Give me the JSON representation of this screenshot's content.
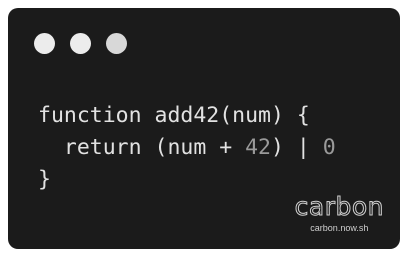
{
  "window": {
    "dots": [
      {
        "name": "window-dot-1",
        "color": "#ececec"
      },
      {
        "name": "window-dot-2",
        "color": "#ececec"
      },
      {
        "name": "window-dot-3",
        "color": "#d8d8d8"
      }
    ]
  },
  "code": {
    "line1": "function add42(num) {",
    "line2_a": "  return (num + ",
    "line2_num": "42",
    "line2_b": ") | ",
    "line2_num2": "0",
    "line3": "}"
  },
  "watermark": {
    "logo": "carbon",
    "url": "carbon.now.sh"
  },
  "colors": {
    "background": "#1b1b1b",
    "code_text": "#e2e2e2",
    "number": "#9a9a9a"
  }
}
